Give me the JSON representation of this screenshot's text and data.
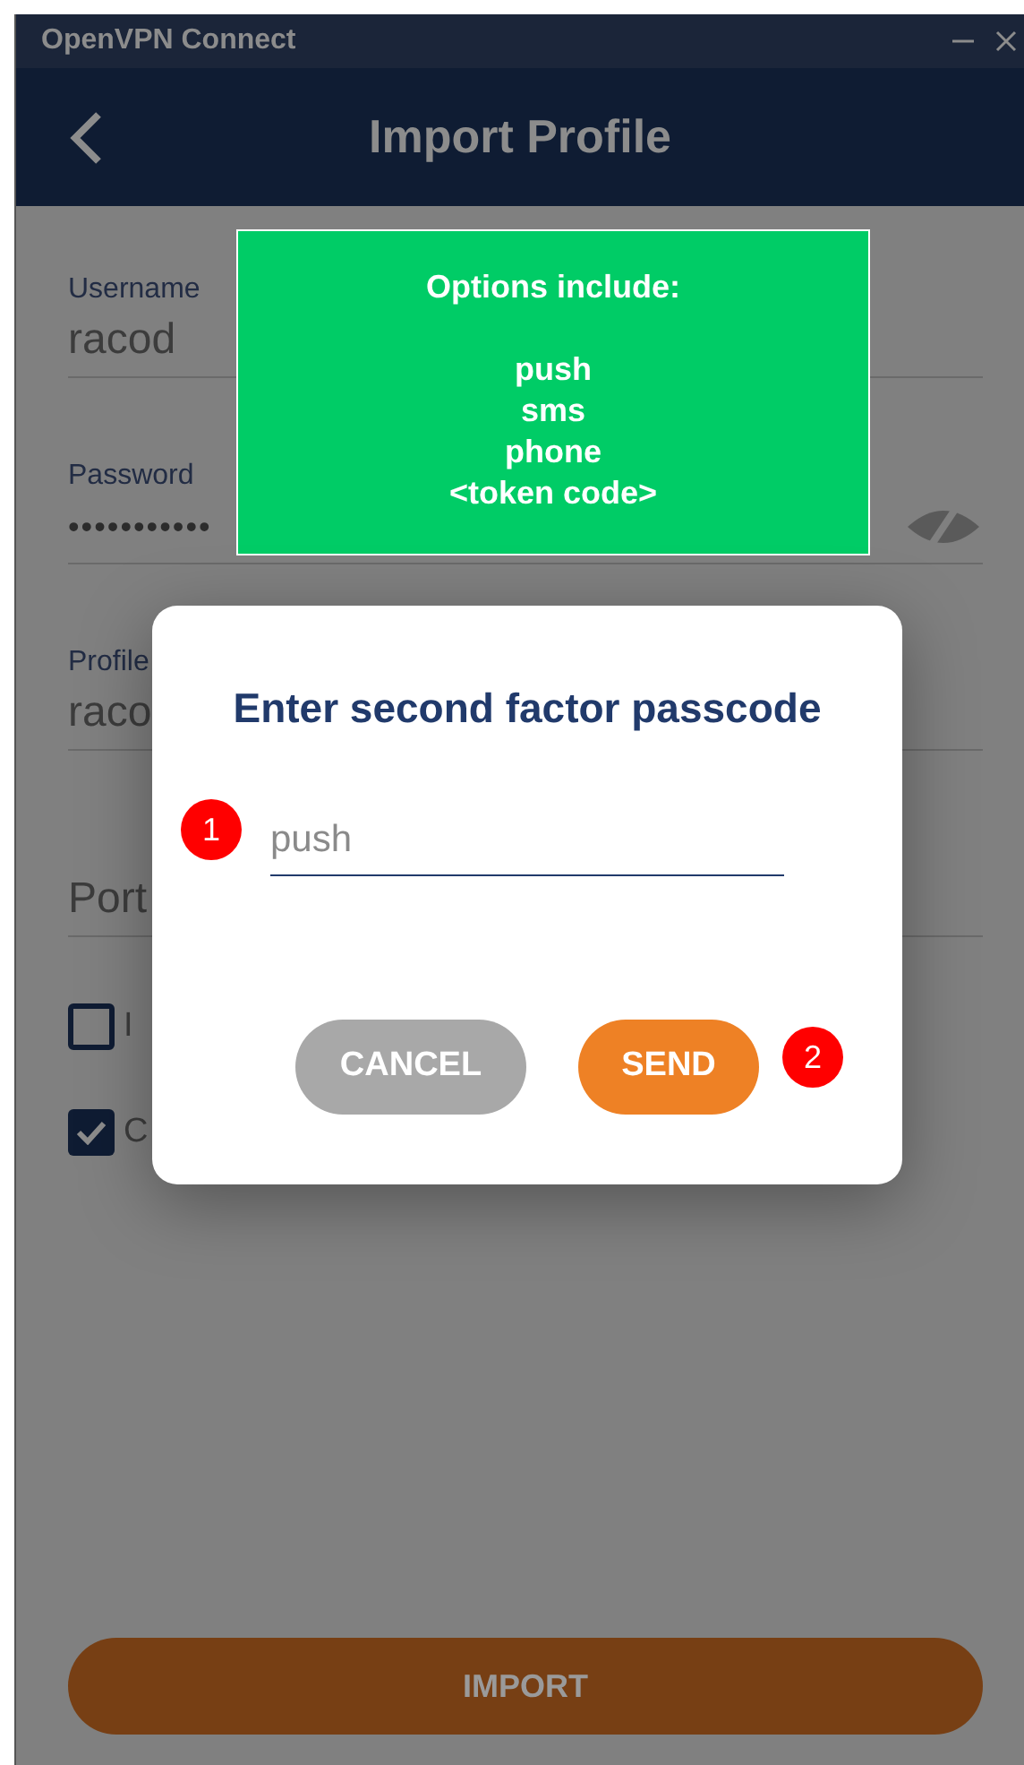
{
  "window": {
    "title": "OpenVPN Connect"
  },
  "header": {
    "title": "Import Profile"
  },
  "form": {
    "fields": [
      {
        "label": "Username",
        "value": "racod",
        "kind": "text"
      },
      {
        "label": "Password",
        "value": "•••••••••••",
        "kind": "password"
      },
      {
        "label": "Profile",
        "value": "raco",
        "kind": "text"
      },
      {
        "label": "Port",
        "kind": "placeholder"
      }
    ],
    "checkboxes": [
      {
        "label": "I",
        "checked": false
      },
      {
        "label": "C",
        "checked": true
      }
    ],
    "import_button": "IMPORT"
  },
  "callout": {
    "title": "Options include:",
    "lines": [
      "push",
      "sms",
      "phone",
      "<token code>"
    ]
  },
  "dialog": {
    "title": "Enter second factor passcode",
    "input": {
      "placeholder": "push"
    },
    "cancel": "CANCEL",
    "send": "SEND"
  },
  "markers": [
    "1",
    "2"
  ]
}
